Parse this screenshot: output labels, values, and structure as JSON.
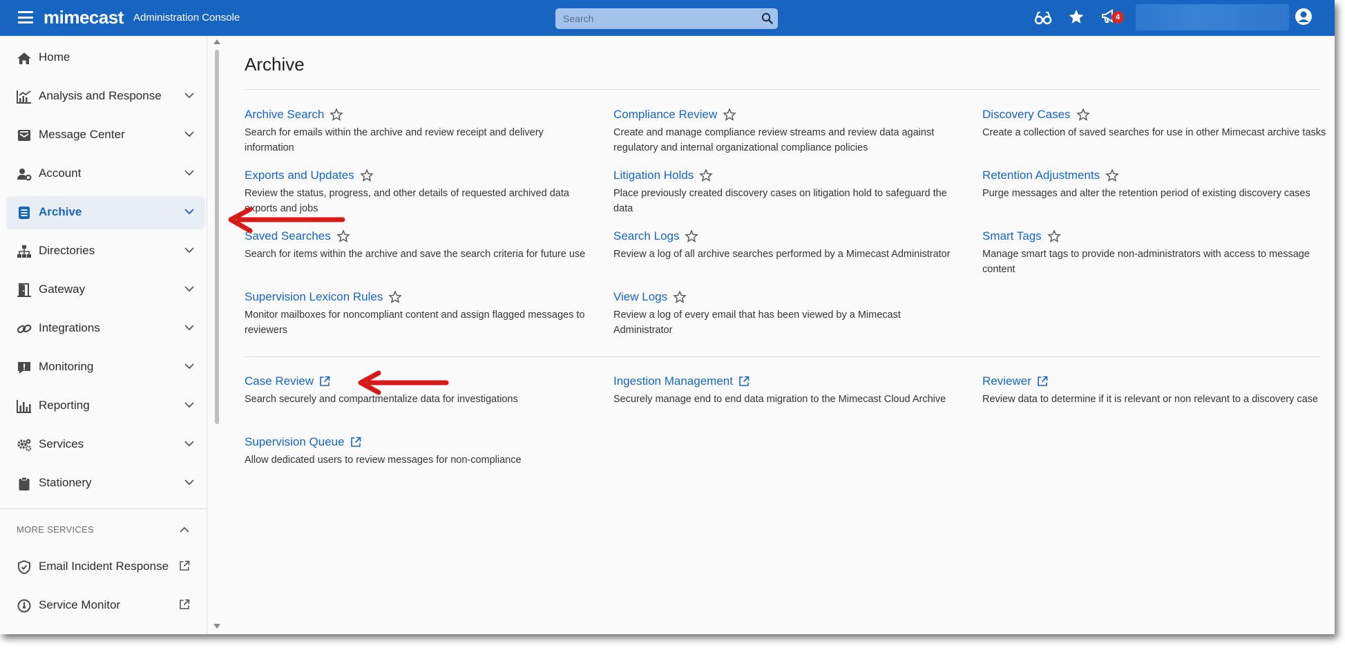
{
  "header": {
    "brand": "mimecast",
    "subtitle": "Administration Console",
    "search_placeholder": "Search",
    "notification_count": "4"
  },
  "sidebar": {
    "items": [
      {
        "label": "Home",
        "icon": "home-icon"
      },
      {
        "label": "Analysis and Response",
        "icon": "chart-icon"
      },
      {
        "label": "Message Center",
        "icon": "inbox-icon"
      },
      {
        "label": "Account",
        "icon": "user-gear-icon"
      },
      {
        "label": "Archive",
        "icon": "archive-icon"
      },
      {
        "label": "Directories",
        "icon": "sitemap-icon"
      },
      {
        "label": "Gateway",
        "icon": "door-icon"
      },
      {
        "label": "Integrations",
        "icon": "link-icon"
      },
      {
        "label": "Monitoring",
        "icon": "alert-icon"
      },
      {
        "label": "Reporting",
        "icon": "bar-chart-icon"
      },
      {
        "label": "Services",
        "icon": "gears-icon"
      },
      {
        "label": "Stationery",
        "icon": "clipboard-icon"
      }
    ],
    "more_services_label": "MORE SERVICES",
    "more_services": [
      {
        "label": "Email Incident Response",
        "icon": "shield-icon"
      },
      {
        "label": "Service Monitor",
        "icon": "gauge-icon"
      }
    ]
  },
  "main": {
    "title": "Archive",
    "cards": [
      {
        "title": "Archive Search",
        "desc": "Search for emails within the archive and review receipt and delivery information"
      },
      {
        "title": "Compliance Review",
        "desc": "Create and manage compliance review streams and review data against regulatory and internal organizational compliance policies"
      },
      {
        "title": "Discovery Cases",
        "desc": "Create a collection of saved searches for use in other Mimecast archive tasks"
      },
      {
        "title": "Exports and Updates",
        "desc": "Review the status, progress, and other details of requested archived data exports and jobs"
      },
      {
        "title": "Litigation Holds",
        "desc": "Place previously created discovery cases on litigation hold to safeguard the data"
      },
      {
        "title": "Retention Adjustments",
        "desc": "Purge messages and alter the retention period of existing discovery cases"
      },
      {
        "title": "Saved Searches",
        "desc": "Search for items within the archive and save the search criteria for future use"
      },
      {
        "title": "Search Logs",
        "desc": "Review a log of all archive searches performed by a Mimecast Administrator"
      },
      {
        "title": "Smart Tags",
        "desc": "Manage smart tags to provide non-administrators with access to message content"
      },
      {
        "title": "Supervision Lexicon Rules",
        "desc": "Monitor mailboxes for noncompliant content and assign flagged messages to reviewers"
      },
      {
        "title": "View Logs",
        "desc": "Review a log of every email that has been viewed by a Mimecast Administrator"
      }
    ],
    "external_cards": [
      {
        "title": "Case Review",
        "desc": "Search securely and compartmentalize data for investigations"
      },
      {
        "title": "Ingestion Management",
        "desc": "Securely manage end to end data migration to the Mimecast Cloud Archive"
      },
      {
        "title": "Reviewer",
        "desc": "Review data to determine if it is relevant or non relevant to a discovery case"
      },
      {
        "title": "Supervision Queue",
        "desc": "Allow dedicated users to review messages for non-compliance"
      }
    ]
  },
  "colors": {
    "brand_blue": "#1865c1",
    "annotation_red": "#d91a1a",
    "badge_red": "#d62828"
  }
}
